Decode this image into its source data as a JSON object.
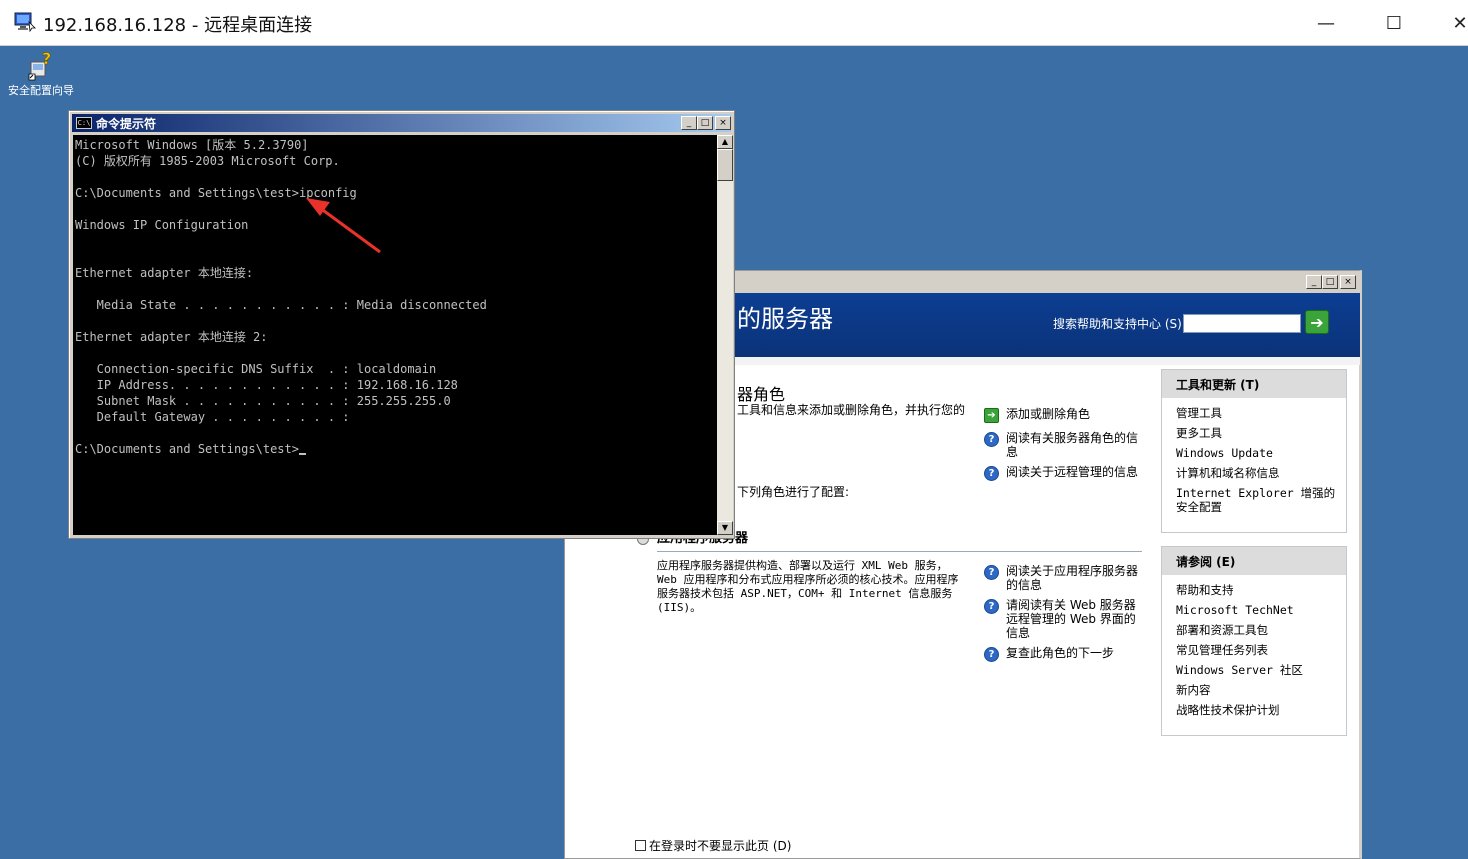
{
  "rdp": {
    "title": "192.168.16.128 - 远程桌面连接",
    "minimize": "—",
    "maximize": "☐",
    "close": "✕"
  },
  "desktop": {
    "icon_label": "安全配置向导"
  },
  "cmd": {
    "title": "命令提示符",
    "icon_text": "C:\\",
    "btn_min": "_",
    "btn_max": "□",
    "btn_close": "×",
    "lines": [
      "Microsoft Windows [版本 5.2.3790]",
      "(C) 版权所有 1985-2003 Microsoft Corp.",
      "",
      "C:\\Documents and Settings\\test>ipconfig",
      "",
      "Windows IP Configuration",
      "",
      "",
      "Ethernet adapter 本地连接:",
      "",
      "   Media State . . . . . . . . . . . : Media disconnected",
      "",
      "Ethernet adapter 本地连接 2:",
      "",
      "   Connection-specific DNS Suffix  . : localdomain",
      "   IP Address. . . . . . . . . . . . : 192.168.16.128",
      "   Subnet Mask . . . . . . . . . . . : 255.255.255.0",
      "   Default Gateway . . . . . . . . . :",
      "",
      "C:\\Documents and Settings\\test>"
    ],
    "scroll_up": "▲",
    "scroll_down": "▼"
  },
  "manage_server": {
    "banner_title": "的服务器",
    "search_label": "搜索帮助和支持中心 (S)",
    "search_go": "➔",
    "role_heading": "器角色",
    "role_desc": "工具和信息来添加或删除角色，并执行您的",
    "role_desc2": "下列角色进行了配置:",
    "role_name": "应用程序服务器",
    "role_body": "应用程序服务器提供构造、部署以及运行 XML Web 服务，Web 应用程序和分布式应用程序所必须的核心技术。应用程序服务器技术包括 ASP.NET，COM+ 和 Internet 信息服务(IIS)。",
    "actions_top": [
      {
        "icon": "➔",
        "label": "添加或删除角色"
      },
      {
        "icon": "?",
        "label": "阅读有关服务器角色的信息"
      },
      {
        "icon": "?",
        "label": "阅读关于远程管理的信息"
      }
    ],
    "actions_role": [
      {
        "icon": "?",
        "label": "阅读关于应用程序服务器的信息"
      },
      {
        "icon": "?",
        "label": "请阅读有关 Web 服务器远程管理的 Web 界面的信息"
      },
      {
        "icon": "?",
        "label": "复查此角色的下一步"
      }
    ],
    "tools_panel": {
      "heading": "工具和更新 (T)",
      "items": [
        "管理工具",
        "更多工具",
        "Windows Update",
        "计算机和域名称信息",
        "Internet Explorer 增强的安全配置"
      ]
    },
    "seealso_panel": {
      "heading": "请参阅 (E)",
      "items": [
        "帮助和支持",
        "Microsoft TechNet",
        "部署和资源工具包",
        "常见管理任务列表",
        "Windows Server 社区",
        "新内容",
        "战略性技术保护计划"
      ]
    },
    "footer_checkbox": "在登录时不要显示此页 (D)",
    "btn_min": "_",
    "btn_max": "□",
    "btn_close": "×"
  },
  "colors": {
    "desktop": "#3a6ea5",
    "banner": "#0d3e93",
    "annotation_arrow": "#e8322a"
  }
}
